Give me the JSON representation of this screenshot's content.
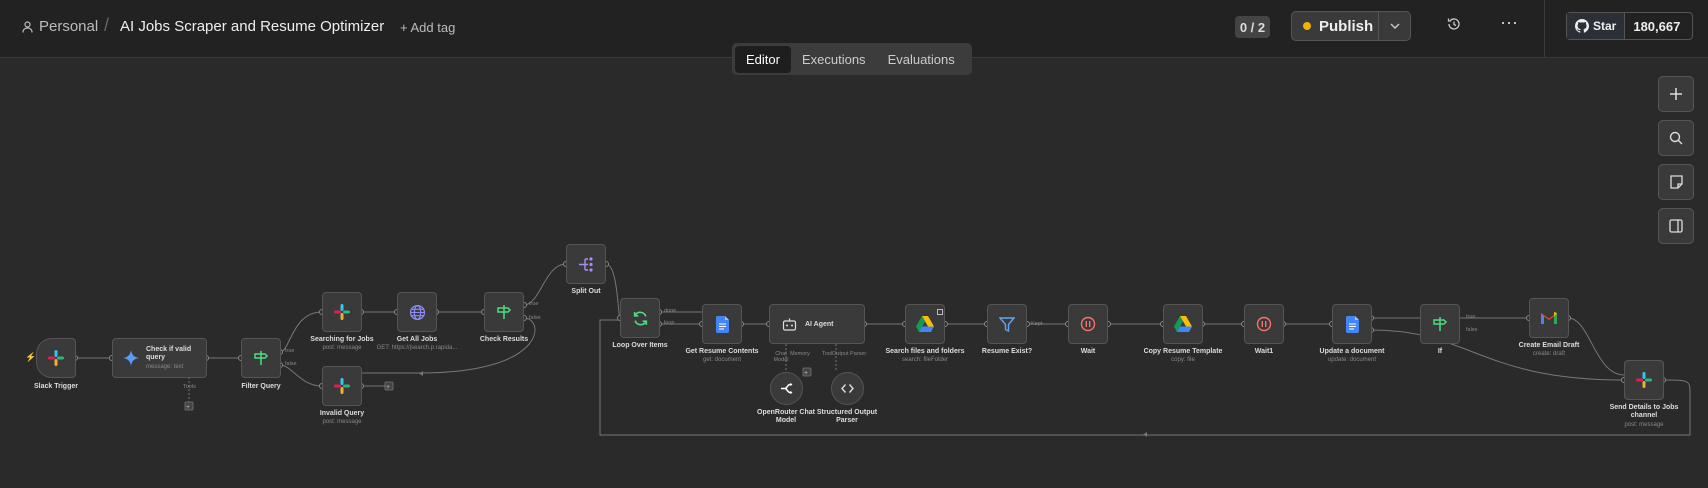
{
  "header": {
    "breadcrumb_personal": "Personal",
    "workflow_title": "AI Jobs Scraper and Resume Optimizer",
    "add_tag": "+ Add tag",
    "counter": "0 / 2",
    "publish_label": "Publish",
    "github_star": "Star",
    "github_count": "180,667"
  },
  "tabs": [
    "Editor",
    "Executions",
    "Evaluations"
  ],
  "active_tab": "Editor",
  "nodes": {
    "slack_trigger": {
      "label": "Slack Trigger"
    },
    "check_valid": {
      "label": "Check if valid query",
      "sub": "message: text",
      "port": "Tools"
    },
    "filter_query": {
      "label": "Filter Query"
    },
    "searching_jobs": {
      "label": "Searching for Jobs",
      "sub": "post: message"
    },
    "invalid_query": {
      "label": "Invalid Query",
      "sub": "post: message"
    },
    "get_all_jobs": {
      "label": "Get All Jobs",
      "sub": "GET: https://jsearch.p.rapida..."
    },
    "check_results": {
      "label": "Check Results"
    },
    "split_out": {
      "label": "Split Out"
    },
    "loop_over": {
      "label": "Loop Over Items"
    },
    "get_resume": {
      "label": "Get Resume Contents",
      "sub": "get: document"
    },
    "ai_agent": {
      "label": "AI Agent",
      "port_chat": "Chat Model",
      "port_memory": "Memory",
      "port_tool": "Tool",
      "port_parser": "Output Parser"
    },
    "openrouter": {
      "label": "OpenRouter Chat Model"
    },
    "structured_parser": {
      "label": "Structured Output Parser",
      "port": "Output Parser"
    },
    "search_files": {
      "label": "Search files and folders",
      "sub": "search: fileFolder"
    },
    "resume_exist": {
      "label": "Resume Exist?",
      "port": "Kept"
    },
    "wait": {
      "label": "Wait"
    },
    "copy_template": {
      "label": "Copy Resume Template",
      "sub": "copy: file"
    },
    "wait1": {
      "label": "Wait1"
    },
    "update_doc": {
      "label": "Update a document",
      "sub": "update: document"
    },
    "if_node": {
      "label": "If"
    },
    "create_email": {
      "label": "Create Email Draft",
      "sub": "create: draft"
    },
    "send_details": {
      "label": "Send Details to Jobs channel",
      "sub": "post: message"
    }
  },
  "branch_labels": {
    "true": "true",
    "false": "false",
    "done": "done",
    "loop": "loop"
  },
  "colors": {
    "accent_publish_dot": "#f0b400",
    "canvas_bg": "#2a2a2a",
    "node_bg": "#3a3a3a"
  }
}
